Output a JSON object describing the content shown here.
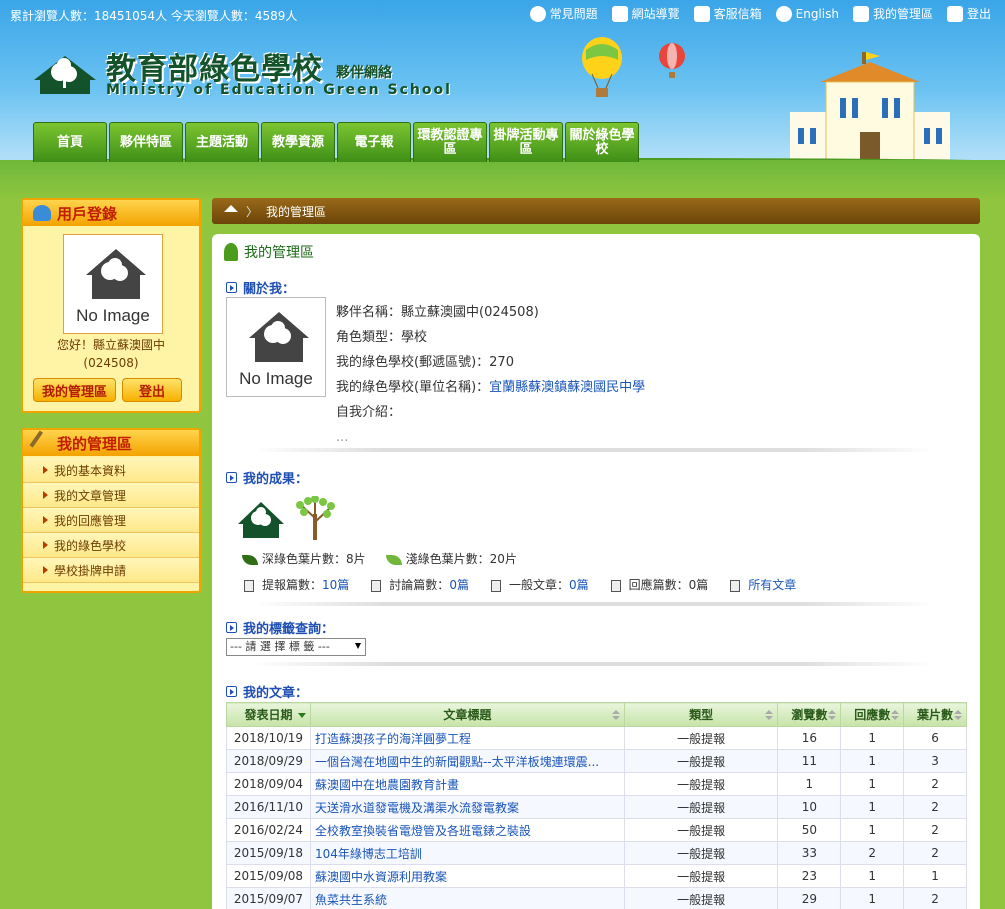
{
  "topbar": {
    "counter_text": "累計瀏覽人數：18451054人 今天瀏覽人數：4589人",
    "links": [
      {
        "icon": "faq-icon",
        "label": "常見問題"
      },
      {
        "icon": "sitemap-icon",
        "label": "網站導覽"
      },
      {
        "icon": "mail-icon",
        "label": "客服信箱"
      },
      {
        "icon": "globe-icon",
        "label": "English"
      },
      {
        "icon": "tools-icon",
        "label": "我的管理區"
      },
      {
        "icon": "logout-icon",
        "label": "登出"
      }
    ]
  },
  "logo": {
    "title_cn": "教育部綠色學校",
    "subtitle_cn": "夥伴網絡",
    "title_en": "Ministry of Education Green School"
  },
  "nav": [
    "首頁",
    "夥伴特區",
    "主題活動",
    "教學資源",
    "電子報",
    "環教認證專區",
    "掛牌活動專區",
    "關於綠色學校"
  ],
  "login": {
    "title": "用戶登錄",
    "no_image": "No Image",
    "greeting": "您好！縣立蘇澳國中",
    "code": "(024508)",
    "manage_button": "我的管理區",
    "logout_button": "登出"
  },
  "menu": {
    "title": "我的管理區",
    "items": [
      "我的基本資料",
      "我的文章管理",
      "我的回應管理",
      "我的綠色學校",
      "學校掛牌申請"
    ]
  },
  "breadcrumb": {
    "current": "我的管理區"
  },
  "main": {
    "title": "我的管理區",
    "about": {
      "heading": "關於我：",
      "no_image": "No Image",
      "partner_label": "夥伴名稱：",
      "partner_value": "縣立蘇澳國中(024508)",
      "role_label": "角色類型：",
      "role_value": "學校",
      "zip_label": "我的綠色學校(郵遞區號)：",
      "zip_value": "270",
      "unit_label": "我的綠色學校(單位名稱)：",
      "unit_value": "宜蘭縣蘇澳鎮蘇澳國民中學",
      "intro_label": "自我介紹：",
      "intro_value": "..."
    },
    "achievements": {
      "heading": "我的成果：",
      "dark_leaf_label": "深綠色葉片數：",
      "dark_leaf_value": "8片",
      "light_leaf_label": "淺綠色葉片數：",
      "light_leaf_value": "20片",
      "posts": [
        {
          "label": "提報篇數：",
          "value": "10篇",
          "link": true
        },
        {
          "label": "討論篇數：",
          "value": "0篇",
          "link": true
        },
        {
          "label": "一般文章：",
          "value": "0篇",
          "link": true
        },
        {
          "label": "回應篇數：",
          "value": "0篇",
          "link": false
        },
        {
          "label": "",
          "value": "所有文章",
          "link": true
        }
      ]
    },
    "tags": {
      "heading": "我的標籤查詢：",
      "select_value": "--- 請 選 擇 標 籤 ---"
    },
    "articles": {
      "heading": "我的文章：",
      "columns": [
        "發表日期",
        "文章標題",
        "類型",
        "瀏覽數",
        "回應數",
        "葉片數"
      ],
      "rows": [
        [
          "2018/10/19",
          "打造蘇澳孩子的海洋圓夢工程",
          "一般提報",
          "16",
          "1",
          "6"
        ],
        [
          "2018/09/29",
          "一個台灣在地國中生的新聞觀點--太平洋板塊連環震...",
          "一般提報",
          "11",
          "1",
          "3"
        ],
        [
          "2018/09/04",
          "蘇澳國中在地農園教育計畫",
          "一般提報",
          "1",
          "1",
          "2"
        ],
        [
          "2016/11/10",
          "天送滑水道發電機及溝渠水流發電教案",
          "一般提報",
          "10",
          "1",
          "2"
        ],
        [
          "2016/02/24",
          "全校教室換裝省電燈管及各班電錶之裝設",
          "一般提報",
          "50",
          "1",
          "2"
        ],
        [
          "2015/09/18",
          "104年綠博志工培訓",
          "一般提報",
          "33",
          "2",
          "2"
        ],
        [
          "2015/09/08",
          "蘇澳國中水資源利用教案",
          "一般提報",
          "23",
          "1",
          "1"
        ],
        [
          "2015/09/07",
          "魚菜共生系統",
          "一般提報",
          "29",
          "1",
          "2"
        ]
      ]
    }
  },
  "colors": {
    "header_sky": "#3aa5e8",
    "grass": "#8fc53f",
    "nav_green": "#4a9c1c",
    "panel_orange": "#f3a300",
    "link_blue": "#1a55b8",
    "breadcrumb_brown": "#7a500e"
  }
}
